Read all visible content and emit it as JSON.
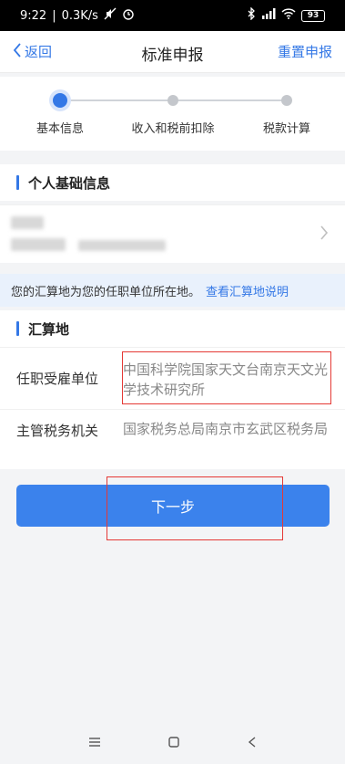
{
  "status_bar": {
    "time": "9:22",
    "speed": "0.3K/s",
    "battery": "93"
  },
  "navbar": {
    "back_label": "返回",
    "title": "标准申报",
    "reset_label": "重置申报"
  },
  "stepper": {
    "steps": [
      {
        "label": "基本信息",
        "active": true
      },
      {
        "label": "收入和税前扣除",
        "active": false
      },
      {
        "label": "税款计算",
        "active": false
      }
    ]
  },
  "personal_section": {
    "title": "个人基础信息"
  },
  "notice": {
    "text": "您的汇算地为您的任职单位所在地。",
    "link": "查看汇算地说明"
  },
  "settlement_section": {
    "title": "汇算地",
    "rows": [
      {
        "label": "任职受雇单位",
        "value": "中国科学院国家天文台南京天文光学技术研究所"
      },
      {
        "label": "主管税务机关",
        "value": "国家税务总局南京市玄武区税务局"
      }
    ]
  },
  "next_button": {
    "label": "下一步"
  },
  "colors": {
    "accent": "#3478e6",
    "button": "#3b82ec",
    "highlight": "#e53935"
  }
}
